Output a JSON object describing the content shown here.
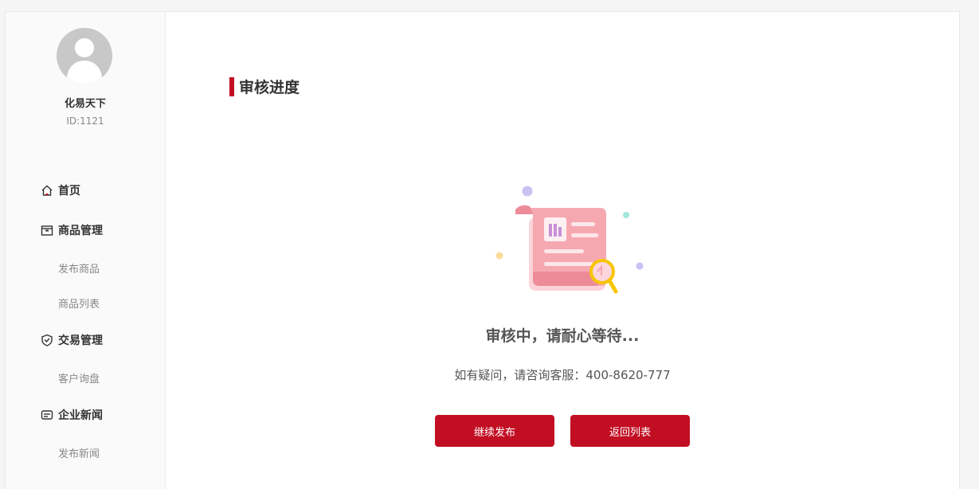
{
  "user": {
    "name": "化易天下",
    "id_label": "ID:1121"
  },
  "sidebar": {
    "items": [
      {
        "label": "首页",
        "icon": "home-icon"
      },
      {
        "label": "商品管理",
        "icon": "product-box-icon",
        "children": [
          "发布商品",
          "商品列表"
        ]
      },
      {
        "label": "交易管理",
        "icon": "trade-shield-icon",
        "children": [
          "客户询盘"
        ]
      },
      {
        "label": "企业新闻",
        "icon": "news-icon",
        "children": [
          "发布新闻"
        ]
      }
    ]
  },
  "main": {
    "section_title": "审核进度",
    "status_text": "审核中，请耐心等待...",
    "contact_text": "如有疑问，请咨询客服：400-8620-777",
    "buttons": {
      "continue_publish": "继续发布",
      "back_to_list": "返回列表"
    }
  },
  "colors": {
    "accent": "#c20e23",
    "illustration_pink": "#f4a1ab",
    "magnifier_yellow": "#f7c500"
  }
}
